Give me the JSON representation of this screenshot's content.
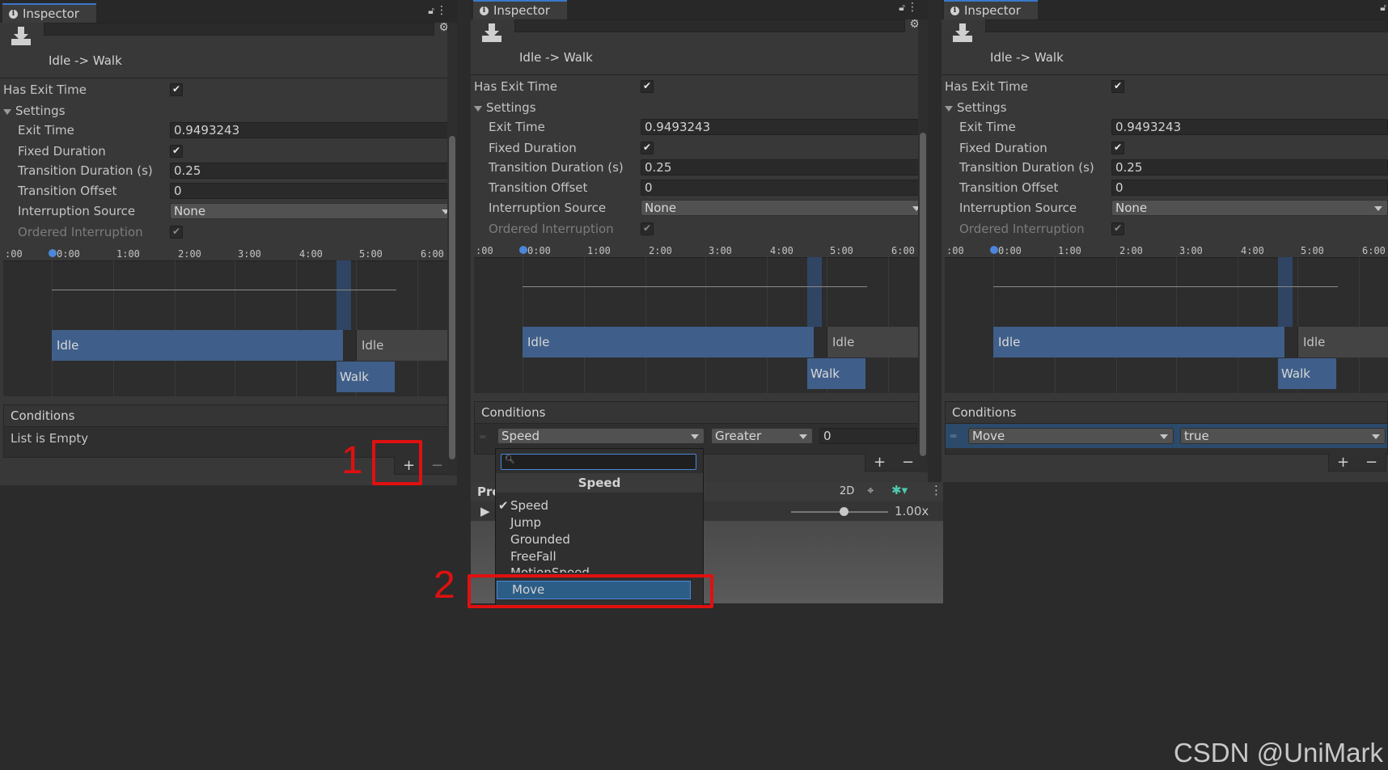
{
  "inspector": {
    "tab_label": "Inspector",
    "transition_title": "Idle -> Walk",
    "has_exit_time_label": "Has Exit Time",
    "settings_label": "Settings",
    "exit_time_label": "Exit Time",
    "exit_time_value": "0.9493243",
    "fixed_duration_label": "Fixed Duration",
    "transition_duration_label": "Transition Duration (s)",
    "transition_duration_value": "0.25",
    "transition_offset_label": "Transition Offset",
    "transition_offset_value": "0",
    "interruption_source_label": "Interruption Source",
    "interruption_source_value": "None",
    "ordered_interruption_label": "Ordered Interruption"
  },
  "timeline": {
    "ticks": [
      ":00",
      "0:00",
      "1:00",
      "2:00",
      "3:00",
      "4:00",
      "5:00",
      "6:00"
    ],
    "source_state": "Idle",
    "dest_state": "Walk",
    "next_state": "Idle"
  },
  "conditions": {
    "header": "Conditions",
    "empty_text": "List is Empty",
    "plus": "+",
    "minus": "−",
    "p2_param": "Speed",
    "p2_operator": "Greater",
    "p2_value": "0",
    "p3_param": "Move",
    "p3_value": "true"
  },
  "dropdown_menu": {
    "header": "Speed",
    "items": [
      "Speed",
      "Jump",
      "Grounded",
      "FreeFall",
      "MotionSpeed",
      "Move"
    ],
    "checked": "Speed",
    "selected": "Move"
  },
  "preview": {
    "label": "Pre",
    "mode_2d": "2D",
    "speed": "1.00x"
  },
  "annotations": {
    "step1": "1",
    "step2": "2"
  },
  "watermark": "CSDN @UniMark"
}
